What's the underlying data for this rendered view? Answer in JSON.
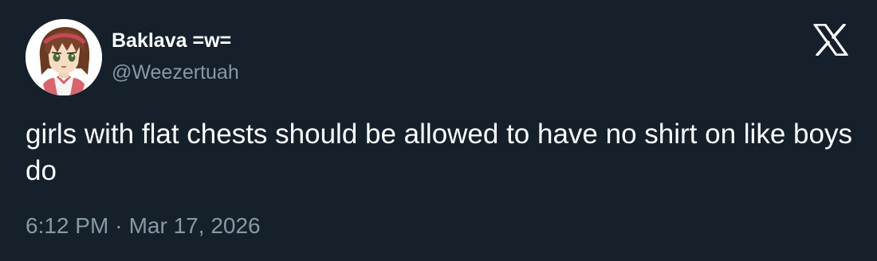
{
  "author": {
    "display_name": "Baklava =w=",
    "handle": "@Weezertuah"
  },
  "tweet": {
    "text": "girls with flat chests should be allowed to have no shirt on like boys do"
  },
  "meta": {
    "time": "6:12 PM",
    "separator": "·",
    "date": "Mar 17, 2026"
  },
  "icons": {
    "avatar": "anime-character-avatar",
    "brand": "x-logo-icon"
  },
  "colors": {
    "background": "#15202b",
    "text_primary": "#ffffff",
    "text_secondary": "#8899a6"
  }
}
